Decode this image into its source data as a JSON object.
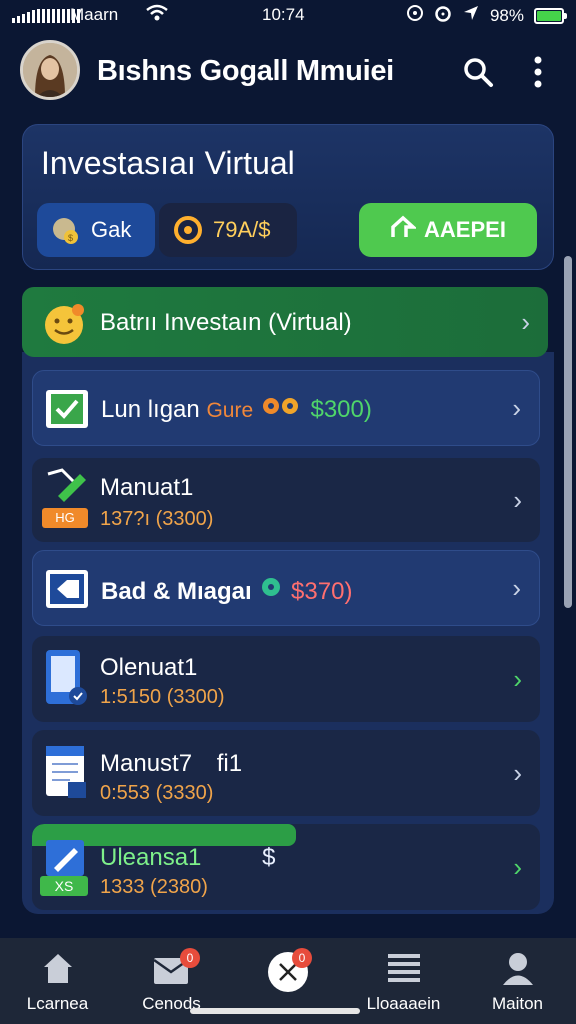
{
  "status_bar": {
    "carrier": "Maarn",
    "time": "10:74",
    "battery": "98%"
  },
  "header": {
    "title": "Bıshns Gogall Mmuiei"
  },
  "virtual_card": {
    "title": "Investasıaı Virtual",
    "chip1_label": "Gak",
    "chip2_label": "79A/$",
    "apply_button": "AAEPEI"
  },
  "banner": {
    "label": "Batrıı Investaın (Virtual)"
  },
  "items": [
    {
      "title": "Lun lıgan",
      "tag": "Gure",
      "amount": "$300)"
    },
    {
      "title": "Manuat1",
      "badge": "HG",
      "sub": "137?ı (3300)"
    },
    {
      "title": "Bad & Mıagaı",
      "amount": "$370)"
    },
    {
      "title": "Olenuat1",
      "sub": "1:5150 (3300)"
    },
    {
      "title": "Manust7",
      "extra": "fi1",
      "sub": "0:553 (3330)"
    },
    {
      "title": "Uleansa1",
      "extra": "$",
      "badge": "XS",
      "sub": "1333 (2380)"
    }
  ],
  "bottom_nav": [
    {
      "label": "Lcarnea"
    },
    {
      "label": "Cenods",
      "badge": "0"
    },
    {
      "label": "",
      "badge": "0"
    },
    {
      "label": "Lloaaaein"
    },
    {
      "label": "Maiton"
    }
  ],
  "colors": {
    "background": "#0b1733",
    "accent_green": "#4fc94f",
    "card": "#1b2f5e"
  }
}
